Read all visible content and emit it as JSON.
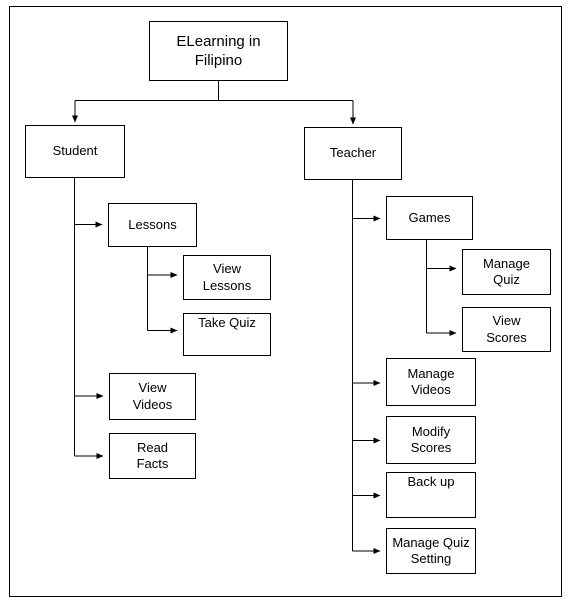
{
  "diagram": {
    "title": "ELearning in Filipino",
    "type": "hierarchy-tree",
    "colors": {
      "background": "#ffffff",
      "box_border": "#000000",
      "connector": "#000000",
      "text": "#000000"
    },
    "root": {
      "label": "ELearning in\nFilipino"
    },
    "branches": [
      {
        "label": "Student",
        "children": [
          {
            "label": "Lessons",
            "children": [
              {
                "label": "View\nLessons"
              },
              {
                "label": "Take Quiz"
              }
            ]
          },
          {
            "label": "View\nVideos"
          },
          {
            "label": "Read\nFacts"
          }
        ]
      },
      {
        "label": "Teacher",
        "children": [
          {
            "label": "Games",
            "children": [
              {
                "label": "Manage\nQuiz"
              },
              {
                "label": "View\nScores"
              }
            ]
          },
          {
            "label": "Manage\nVideos"
          },
          {
            "label": "Modify\nScores"
          },
          {
            "label": "Back up"
          },
          {
            "label": "Manage Quiz\nSetting"
          }
        ]
      }
    ]
  }
}
